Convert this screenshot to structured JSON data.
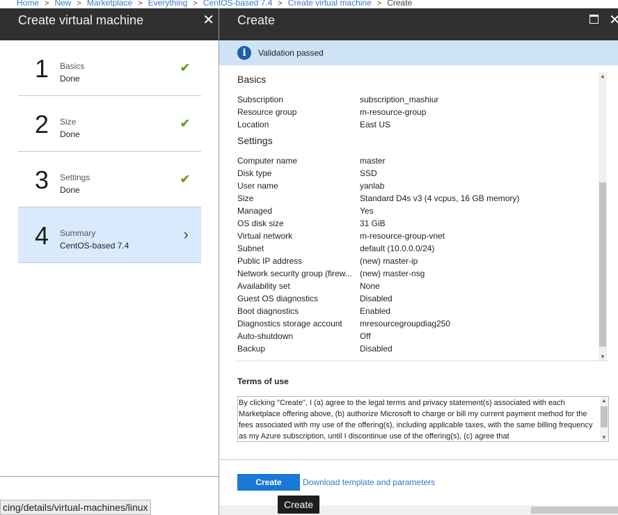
{
  "breadcrumb": {
    "items": [
      "Home",
      "New",
      "Marketplace",
      "Everything",
      "CentOS-based 7.4",
      "Create virtual machine"
    ],
    "current": "Create",
    "separator": ">"
  },
  "left_blade": {
    "title": "Create virtual machine",
    "close_glyph": "✕",
    "steps": [
      {
        "number": "1",
        "title": "Basics",
        "status": "Done",
        "icon": "check-icon",
        "glyph": "✔"
      },
      {
        "number": "2",
        "title": "Size",
        "status": "Done",
        "icon": "check-icon",
        "glyph": "✔"
      },
      {
        "number": "3",
        "title": "Settings",
        "status": "Done",
        "icon": "check-icon",
        "glyph": "✔"
      },
      {
        "number": "4",
        "title": "Summary",
        "status": "CentOS-based 7.4",
        "icon": "chevron-right-icon",
        "glyph": "›"
      }
    ]
  },
  "right_blade": {
    "title": "Create",
    "close_glyph": "✕",
    "validation": {
      "icon_glyph": "i",
      "text": "Validation passed"
    },
    "sections": [
      {
        "title": "Basics",
        "rows": [
          {
            "key": "Subscription",
            "value": "subscription_mashiur"
          },
          {
            "key": "Resource group",
            "value": "m-resource-group"
          },
          {
            "key": "Location",
            "value": "East US"
          }
        ]
      },
      {
        "title": "Settings",
        "rows": [
          {
            "key": "Computer name",
            "value": "master"
          },
          {
            "key": "Disk type",
            "value": "SSD"
          },
          {
            "key": "User name",
            "value": "yanlab"
          },
          {
            "key": "Size",
            "value": "Standard D4s v3 (4 vcpus, 16 GB memory)"
          },
          {
            "key": "Managed",
            "value": "Yes"
          },
          {
            "key": "OS disk size",
            "value": "31 GiB"
          },
          {
            "key": "Virtual network",
            "value": "m-resource-group-vnet"
          },
          {
            "key": "Subnet",
            "value": "default (10.0.0.0/24)"
          },
          {
            "key": "Public IP address",
            "value": "(new) master-ip"
          },
          {
            "key": "Network security group (firew...",
            "value": "(new) master-nsg"
          },
          {
            "key": "Availability set",
            "value": "None"
          },
          {
            "key": "Guest OS diagnostics",
            "value": "Disabled"
          },
          {
            "key": "Boot diagnostics",
            "value": "Enabled"
          },
          {
            "key": "Diagnostics storage account",
            "value": "mresourcegroupdiag250"
          },
          {
            "key": "Auto-shutdown",
            "value": "Off"
          },
          {
            "key": "Backup",
            "value": "Disabled"
          }
        ]
      }
    ],
    "terms": {
      "title": "Terms of use",
      "text": "By clicking \"Create\", I (a) agree to the legal terms and privacy statement(s) associated with each Marketplace offering above, (b) authorize Microsoft to charge or bill my current payment method for the fees associated with my use of the offering(s), including applicable taxes, with the same billing frequency as my Azure subscription, until I discontinue use of the offering(s), (c) agree that"
    },
    "create_label": "Create",
    "download_label": "Download template and parameters"
  },
  "tooltip": "Create",
  "status_url": "cing/details/virtual-machines/linux",
  "colors": {
    "header_bg": "#303030",
    "selected_step_bg": "#d8eafb",
    "validation_bg": "#cfe3f6",
    "primary_button": "#1a78d6",
    "check": "#6b9e1f"
  }
}
